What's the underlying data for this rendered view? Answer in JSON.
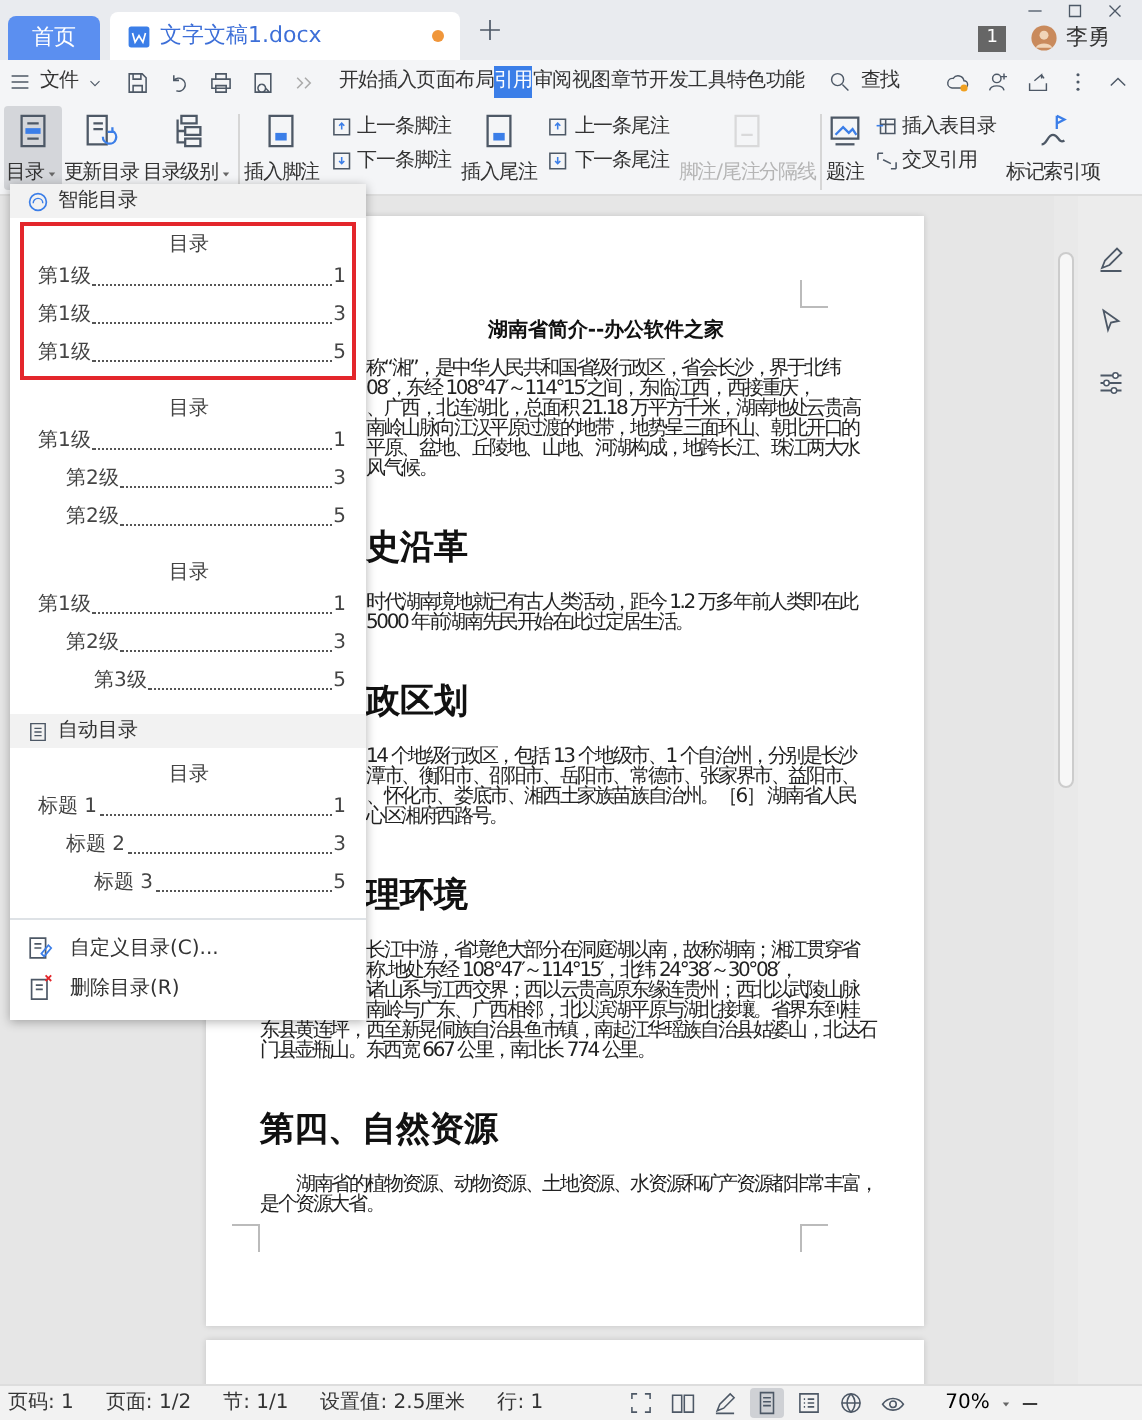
{
  "tabs": [
    {
      "label": "首页",
      "kind": "home",
      "selected": false
    },
    {
      "label": "文字文稿1.docx",
      "kind": "document",
      "selected": true,
      "unsaved": true
    }
  ],
  "account": {
    "notification_count": "1",
    "user_name": "李勇"
  },
  "menu_bar": {
    "file_label": "文件",
    "tabs": [
      {
        "label": "开始",
        "selected": false
      },
      {
        "label": "插入",
        "selected": false
      },
      {
        "label": "页面布局",
        "selected": false
      },
      {
        "label": "引用",
        "selected": true
      },
      {
        "label": "审阅",
        "selected": false
      },
      {
        "label": "视图",
        "selected": false
      },
      {
        "label": "章节",
        "selected": false
      },
      {
        "label": "开发工具",
        "selected": false
      },
      {
        "label": "特色功能",
        "selected": false
      }
    ],
    "search_label": "查找"
  },
  "ribbon": {
    "items": [
      {
        "kind": "large",
        "label": "目录",
        "pressed": true,
        "dropdown": true,
        "disabled": false
      },
      {
        "kind": "large",
        "label": "更新目录",
        "pressed": false,
        "dropdown": false,
        "disabled": false
      },
      {
        "kind": "large",
        "label": "目录级别",
        "pressed": false,
        "dropdown": true,
        "disabled": false
      },
      {
        "kind": "separator"
      },
      {
        "kind": "large",
        "label": "插入脚注",
        "pressed": false,
        "dropdown": false,
        "disabled": false
      },
      {
        "kind": "pair",
        "labels": [
          "上一条脚注",
          "下一条脚注"
        ]
      },
      {
        "kind": "large",
        "label": "插入尾注",
        "pressed": false,
        "dropdown": false,
        "disabled": false
      },
      {
        "kind": "pair",
        "labels": [
          "上一条尾注",
          "下一条尾注"
        ]
      },
      {
        "kind": "large",
        "label": "脚注/尾注分隔线",
        "pressed": false,
        "dropdown": false,
        "disabled": true
      },
      {
        "kind": "separator"
      },
      {
        "kind": "large",
        "label": "题注",
        "pressed": false,
        "dropdown": false,
        "disabled": false
      },
      {
        "kind": "pair",
        "labels": [
          "插入表目录",
          "交叉引用"
        ]
      },
      {
        "kind": "large",
        "label": "标记索引项",
        "pressed": false,
        "dropdown": false,
        "disabled": false
      }
    ]
  },
  "toc_menu": {
    "sections": [
      {
        "kind": "smart",
        "title": "智能目录",
        "previews": [
          {
            "selected": true,
            "heading": "目录",
            "entries": [
              {
                "label": "第1级",
                "page": "1"
              },
              {
                "label": "第1级",
                "page": "3"
              },
              {
                "label": "第1级",
                "page": "5"
              }
            ]
          },
          {
            "selected": false,
            "heading": "目录",
            "entries": [
              {
                "label": "第1级",
                "page": "1",
                "children": [
                  {
                    "label": "第2级",
                    "page": "3"
                  },
                  {
                    "label": "第2级",
                    "page": "5"
                  }
                ]
              }
            ]
          },
          {
            "selected": false,
            "heading": "目录",
            "entries": [
              {
                "label": "第1级",
                "page": "1",
                "children": [
                  {
                    "label": "第2级",
                    "page": "3",
                    "children": [
                      {
                        "label": "第3级",
                        "page": "5"
                      }
                    ]
                  }
                ]
              }
            ]
          }
        ]
      },
      {
        "kind": "auto",
        "title": "自动目录",
        "previews": [
          {
            "selected": false,
            "heading": "目录",
            "entries": [
              {
                "label": "标题 1",
                "page": "1",
                "children": [
                  {
                    "label": "标题 2",
                    "page": "3",
                    "children": [
                      {
                        "label": "标题 3",
                        "page": "5"
                      }
                    ]
                  }
                ]
              }
            ]
          }
        ]
      }
    ],
    "actions": [
      {
        "kind": "custom",
        "label": "自定义目录(C)..."
      },
      {
        "kind": "delete",
        "label": "删除目录(R)"
      }
    ]
  },
  "document": {
    "title": "湖南省简介--办公软件之家",
    "blocks": [
      {
        "kind": "para",
        "lines": [
          {
            "text": "称“湘”，是中华人民共和国省级行政区，省会长沙，界于北纬",
            "cut": true
          },
          {
            "text": "08′，东经 108°47′～114°15′之间，东临江西，西接重庆，",
            "cut": true
          },
          {
            "text": "、广西，北连湖北，总面积 21.18 万平方千米，湖南地处云贵高",
            "cut": true
          },
          {
            "text": "南岭山脉向江汉平原过渡的地带，地势呈三面环山、朝北开口的",
            "cut": true
          },
          {
            "text": "平原、盆地、丘陵地、山地、河湖构成，地跨长江、珠江两大水",
            "cut": true
          },
          {
            "text": "风气候。",
            "cut": true
          }
        ]
      },
      {
        "kind": "heading",
        "text": "史沿革",
        "cut": true
      },
      {
        "kind": "para",
        "lines": [
          {
            "text": "时代湖南境地就已有古人类活动，距今 1.2 万多年前人类即在此",
            "cut": true
          },
          {
            "text": "5000 年前湖南先民开始在此过定居生活。",
            "cut": true
          }
        ]
      },
      {
        "kind": "heading",
        "text": "政区划",
        "cut": true
      },
      {
        "kind": "para",
        "lines": [
          {
            "text": "14 个地级行政区，包括 13 个地级市、1 个自治州，分别是长沙",
            "cut": true
          },
          {
            "text": "潭市、衡阳市、邵阳市、岳阳市、常德市、张家界市、益阳市、",
            "cut": true
          },
          {
            "text": "、怀化市、娄底市、湘西土家族苗族自治州。［6］ 湖南省人民",
            "cut": true
          },
          {
            "text": "心区湘府西路号。",
            "cut": true
          }
        ]
      },
      {
        "kind": "heading",
        "text": "理环境",
        "cut": true
      },
      {
        "kind": "para",
        "lines": [
          {
            "text": "长江中游，省境绝大部分在洞庭湖以南，故称湖南；湘江贯穿省",
            "cut": true
          },
          {
            "text": "称.地处东经 108°47′～114°15′，北纬 24°38′～30°08′，",
            "cut": true
          },
          {
            "text": "诸山系与江西交界；西以云贵高原东缘连贵州；西北以武陵山脉",
            "cut": true
          },
          {
            "text": "南岭与广东、广西相邻，北以滨湖平原与湖北接壤。省界东到桂",
            "cut": true
          },
          {
            "text": "东县黄连坪，西至新晃侗族自治县鱼市镇，南起江华瑶族自治县姑婆山，北达石",
            "cut": false
          },
          {
            "text": "门县壶瓶山。东西宽 667 公里，南北长 774 公里。",
            "cut": false
          }
        ]
      },
      {
        "kind": "heading",
        "text": "第四、自然资源",
        "cut": false
      },
      {
        "kind": "para",
        "lines": [
          {
            "text": "湖南省的植物资源、动物资源、土地资源、水资源和矿产资源都非常丰富，",
            "cut": false
          },
          {
            "text": "是个资源大省。",
            "cut": false
          }
        ]
      }
    ]
  },
  "status_bar": {
    "fields": [
      "页码: 1",
      "页面: 1/2",
      "节: 1/1",
      "设置值: 2.5厘米",
      "行: 1"
    ],
    "views": [
      {
        "selected": false
      },
      {
        "selected": false
      },
      {
        "selected": false
      },
      {
        "selected": true
      },
      {
        "selected": false
      },
      {
        "selected": false
      },
      {
        "selected": false
      }
    ],
    "zoom": "70%"
  }
}
